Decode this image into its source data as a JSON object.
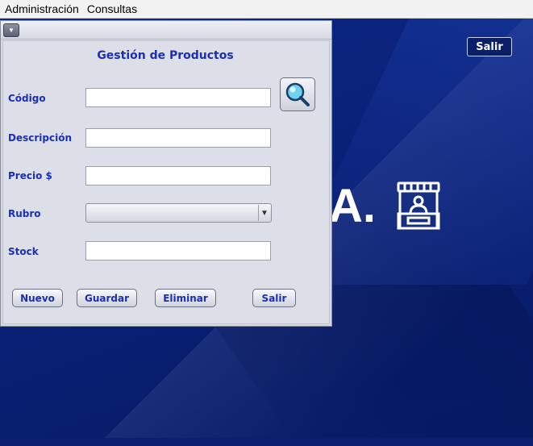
{
  "menubar": {
    "items": [
      {
        "label": "Administración"
      },
      {
        "label": "Consultas"
      }
    ]
  },
  "desktop": {
    "brand_fragment": "A.",
    "exit_label": "Salir"
  },
  "form": {
    "title": "Gestión de Productos",
    "fields": {
      "codigo": {
        "label": "Código",
        "value": ""
      },
      "descripcion": {
        "label": "Descripción",
        "value": ""
      },
      "precio": {
        "label": "Precio $",
        "value": ""
      },
      "rubro": {
        "label": "Rubro",
        "value": ""
      },
      "stock": {
        "label": "Stock",
        "value": ""
      }
    },
    "buttons": {
      "nuevo": "Nuevo",
      "guardar": "Guardar",
      "eliminar": "Eliminar",
      "salir": "Salir"
    }
  },
  "colors": {
    "desktop_bg": "#0a1f6e",
    "label_blue": "#1a2fb8",
    "frame_bg": "#dcdfe7"
  },
  "icons": {
    "search": "magnifier-icon",
    "frame_menu": "chevron-down-icon",
    "kiosk": "store-kiosk-icon"
  }
}
